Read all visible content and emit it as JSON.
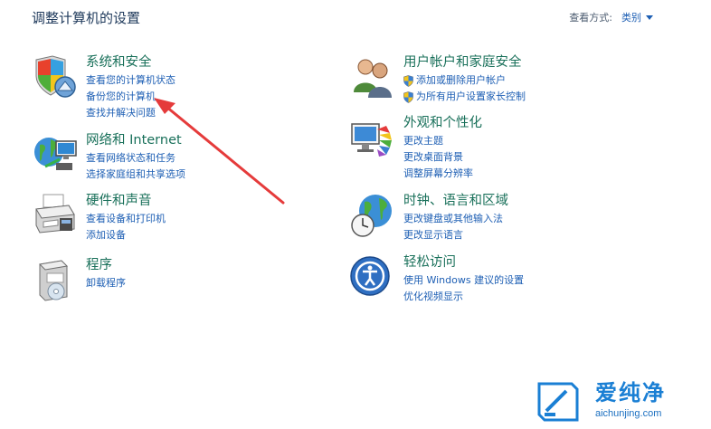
{
  "header": {
    "title": "调整计算机的设置"
  },
  "view_by": {
    "label": "查看方式:",
    "selected": "类别"
  },
  "categories": [
    {
      "title": "系统和安全",
      "icon": "shield-computer-icon",
      "links": [
        "查看您的计算机状态",
        "备份您的计算机",
        "查找并解决问题"
      ]
    },
    {
      "title": "网络和 Internet",
      "icon": "network-globe-icon",
      "links": [
        "查看网络状态和任务",
        "选择家庭组和共享选项"
      ]
    },
    {
      "title": "硬件和声音",
      "icon": "printer-icon",
      "links": [
        "查看设备和打印机",
        "添加设备"
      ]
    },
    {
      "title": "程序",
      "icon": "programs-box-icon",
      "links": [
        "卸载程序"
      ]
    },
    {
      "title": "用户帐户和家庭安全",
      "icon": "users-icon",
      "links": [
        "添加或删除用户帐户",
        "为所有用户设置家长控制"
      ]
    },
    {
      "title": "外观和个性化",
      "icon": "monitor-palette-icon",
      "links": [
        "更改主题",
        "更改桌面背景",
        "调整屏幕分辨率"
      ]
    },
    {
      "title": "时钟、语言和区域",
      "icon": "globe-clock-icon",
      "links": [
        "更改键盘或其他输入法",
        "更改显示语言"
      ]
    },
    {
      "title": "轻松访问",
      "icon": "ease-of-access-icon",
      "links": [
        "使用 Windows 建议的设置",
        "优化视频显示"
      ]
    }
  ],
  "watermark": {
    "brand": "爱纯净",
    "url": "aichunjing.com"
  },
  "colors": {
    "title_green": "#19705a",
    "link_blue": "#1e5fb4",
    "heading": "#1e395b",
    "arrow_red": "#e53b3b"
  }
}
